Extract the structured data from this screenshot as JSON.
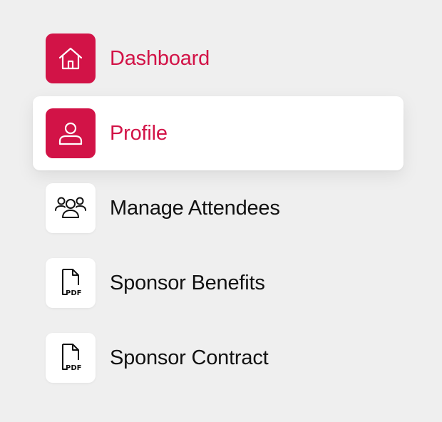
{
  "colors": {
    "accent": "#d21347",
    "text": "#111111",
    "background": "#efefef",
    "active_background": "#ffffff"
  },
  "menu": {
    "items": [
      {
        "label": "Dashboard",
        "icon": "home-icon",
        "state": "highlighted"
      },
      {
        "label": "Profile",
        "icon": "user-icon",
        "state": "active"
      },
      {
        "label": "Manage Attendees",
        "icon": "users-icon",
        "state": "default"
      },
      {
        "label": "Sponsor Benefits",
        "icon": "pdf-file-icon",
        "icon_text": "PDF",
        "state": "default"
      },
      {
        "label": "Sponsor Contract",
        "icon": "pdf-file-icon",
        "icon_text": "PDF",
        "state": "default"
      }
    ]
  }
}
